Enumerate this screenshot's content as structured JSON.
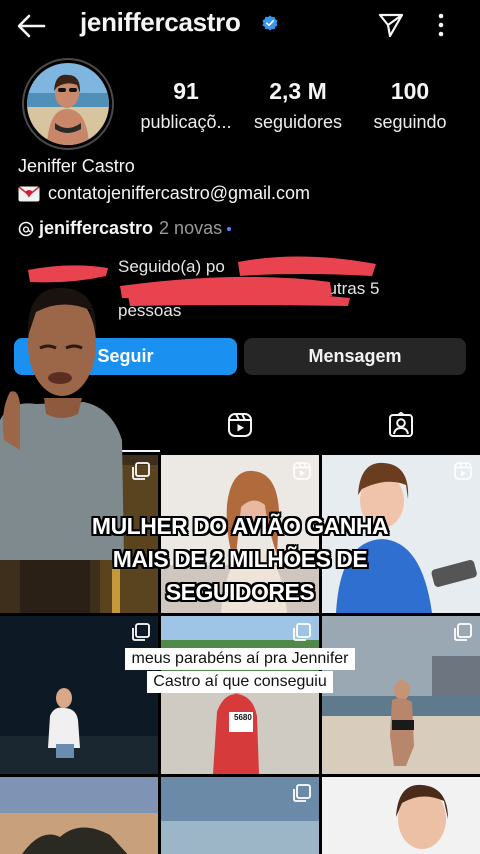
{
  "header": {
    "username": "jeniffercastro",
    "icons": [
      "back-arrow-icon",
      "verified-badge-icon",
      "send-icon",
      "more-vertical-icon"
    ]
  },
  "stats": {
    "posts": {
      "value": "91",
      "label": "publicaçõ..."
    },
    "followers": {
      "value": "2,3 M",
      "label": "seguidores"
    },
    "following": {
      "value": "100",
      "label": "seguindo"
    }
  },
  "profile": {
    "full_name": "Jeniffer Castro",
    "email": "contatojeniffercastro@gmail.com",
    "threads_handle": "jeniffercastro",
    "threads_new": "2 novas",
    "followed_by_line1": "Seguido(a) po",
    "followed_by_line2": "outras 5",
    "followed_by_line3": "pessoas"
  },
  "buttons": {
    "follow": "Seguir",
    "message": "Mensagem"
  },
  "tabs": [
    "grid-tab",
    "reels-tab",
    "tagged-tab"
  ],
  "overlay": {
    "headline_line1": "MULHER DO AVIÃO GANHA",
    "headline_line2": "MAIS DE 2 MILHÕES DE",
    "headline_line3": "SEGUIDORES",
    "subtitle_line1": "meus parabéns aí pra Jennifer",
    "subtitle_line2": "Castro aí que conseguiu"
  },
  "posts": {
    "runner_bib": "5680"
  },
  "colors": {
    "follow_button": "#1a91f0",
    "message_button": "#262626",
    "verified": "#3797f0",
    "redaction": "#e8434e"
  }
}
